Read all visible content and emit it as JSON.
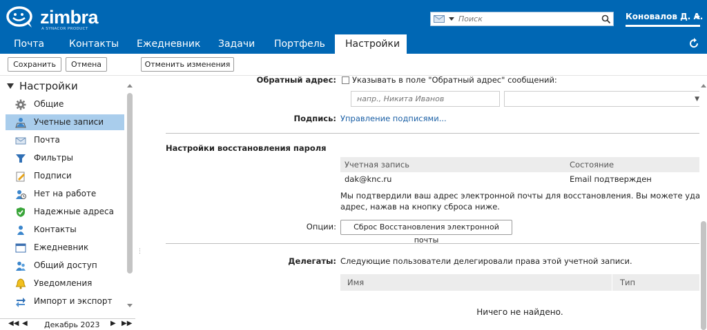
{
  "brand": {
    "name": "zimbra",
    "tagline": "A SYNACOR PRODUCT"
  },
  "search": {
    "placeholder": "Поиск"
  },
  "user": {
    "name": "Коновалов Д. А."
  },
  "tabs": [
    {
      "label": "Почта"
    },
    {
      "label": "Контакты"
    },
    {
      "label": "Ежедневник"
    },
    {
      "label": "Задачи"
    },
    {
      "label": "Портфель"
    },
    {
      "label": "Настройки"
    }
  ],
  "toolbar": {
    "save": "Сохранить",
    "cancel": "Отмена",
    "revert": "Отменить изменения"
  },
  "sidebar": {
    "title": "Настройки",
    "items": [
      {
        "label": "Общие",
        "icon": "gear-icon"
      },
      {
        "label": "Учетные записи",
        "icon": "accounts-icon"
      },
      {
        "label": "Почта",
        "icon": "mail-icon"
      },
      {
        "label": "Фильтры",
        "icon": "filter-icon"
      },
      {
        "label": "Подписи",
        "icon": "signature-icon"
      },
      {
        "label": "Нет на работе",
        "icon": "out-of-office-icon"
      },
      {
        "label": "Надежные адреса",
        "icon": "shield-icon"
      },
      {
        "label": "Контакты",
        "icon": "contact-icon"
      },
      {
        "label": "Ежедневник",
        "icon": "calendar-icon"
      },
      {
        "label": "Общий доступ",
        "icon": "sharing-icon"
      },
      {
        "label": "Уведомления",
        "icon": "bell-icon"
      },
      {
        "label": "Импорт и экспорт",
        "icon": "import-export-icon"
      }
    ],
    "calendar": "Декабрь 2023"
  },
  "main": {
    "reply_to": {
      "label": "Обратный адрес:",
      "checkbox_text": "Указывать в поле \"Обратный адрес\" сообщений:",
      "name_placeholder": "напр., Никита Иванов"
    },
    "signature": {
      "label": "Подпись:",
      "link": "Управление подписями..."
    },
    "recovery": {
      "heading": "Настройки восстановления пароля",
      "col_account": "Учетная запись",
      "col_status": "Состояние",
      "account": "dak@knc.ru",
      "status": "Email подтвержден",
      "note_line1": "Мы подтвердили ваш адрес электронной почты для восстановления. Вы можете удалить этот",
      "note_line2": "адрес, нажав на кнопку сброса ниже.",
      "options_label": "Опции:",
      "reset_button": "Сброс Восстановления электронной почты"
    },
    "delegates": {
      "label": "Делегаты:",
      "text": "Следующие пользователи делегировали права этой учетной записи.",
      "col_name": "Имя",
      "col_type": "Тип",
      "empty": "Ничего не найдено."
    }
  },
  "colors": {
    "brand_blue": "#0067b4",
    "selection": "#a9cdec",
    "link": "#1a5fa5"
  }
}
